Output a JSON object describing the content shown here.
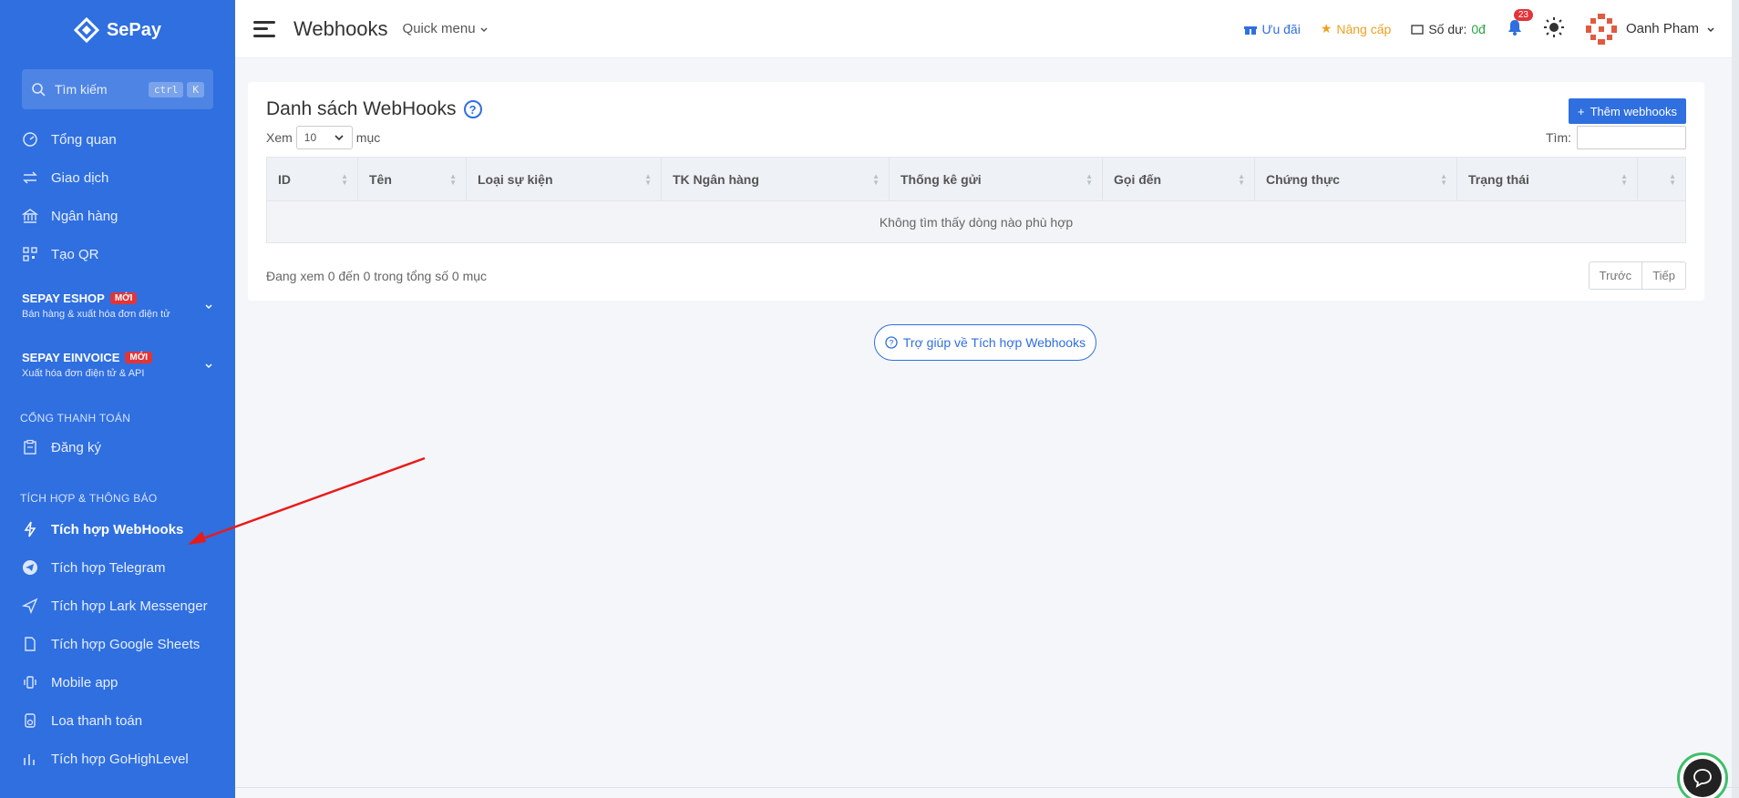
{
  "brand": {
    "name": "SePay"
  },
  "search": {
    "placeholder": "Tìm kiếm",
    "kbd1": "ctrl",
    "kbd2": "K"
  },
  "nav_main": [
    {
      "label": "Tổng quan",
      "icon": "dashboard-icon"
    },
    {
      "label": "Giao dịch",
      "icon": "transfer-icon"
    },
    {
      "label": "Ngân hàng",
      "icon": "bank-icon"
    },
    {
      "label": "Tạo QR",
      "icon": "qr-icon"
    }
  ],
  "groups": [
    {
      "title": "SEPAY ESHOP",
      "badge": "MỚI",
      "sub": "Bán hàng & xuất hóa đơn điện tử"
    },
    {
      "title": "SEPAY EINVOICE",
      "badge": "MỚI",
      "sub": "Xuất hóa đơn điện tử & API"
    }
  ],
  "section_payment": {
    "title": "CỔNG THANH TOÁN",
    "item": "Đăng ký"
  },
  "section_integration": {
    "title": "TÍCH HỢP & THÔNG BÁO",
    "items": [
      {
        "label": "Tích hợp WebHooks",
        "active": true
      },
      {
        "label": "Tích hợp Telegram"
      },
      {
        "label": "Tích hợp Lark Messenger"
      },
      {
        "label": "Tích hợp Google Sheets"
      },
      {
        "label": "Mobile app"
      },
      {
        "label": "Loa thanh toán"
      },
      {
        "label": "Tích hợp GoHighLevel"
      }
    ]
  },
  "topbar": {
    "title": "Webhooks",
    "quick_menu": "Quick menu",
    "promo": "Ưu đãi",
    "upgrade": "Nâng cấp",
    "balance_label": "Số dư:",
    "balance_value": "0đ",
    "notifications": "23",
    "user": "Oanh Pham"
  },
  "colors": {
    "primary": "#2f6fe0",
    "warning": "#f0a020",
    "success": "#28a745",
    "danger": "#e0353b"
  },
  "card": {
    "title": "Danh sách WebHooks",
    "add_button": "Thêm webhooks",
    "show_label": "Xem",
    "page_size": "10",
    "entries_label": "mục",
    "search_label": "Tìm:",
    "columns": [
      "ID",
      "Tên",
      "Loại sự kiện",
      "TK Ngân hàng",
      "Thống kê gửi",
      "Gọi đến",
      "Chứng thực",
      "Trạng thái",
      ""
    ],
    "empty_message": "Không tìm thấy dòng nào phù hợp",
    "info": "Đang xem 0 đến 0 trong tổng số 0 mục",
    "prev": "Trước",
    "next": "Tiếp"
  },
  "help": {
    "label": "Trợ giúp về Tích hợp Webhooks"
  }
}
